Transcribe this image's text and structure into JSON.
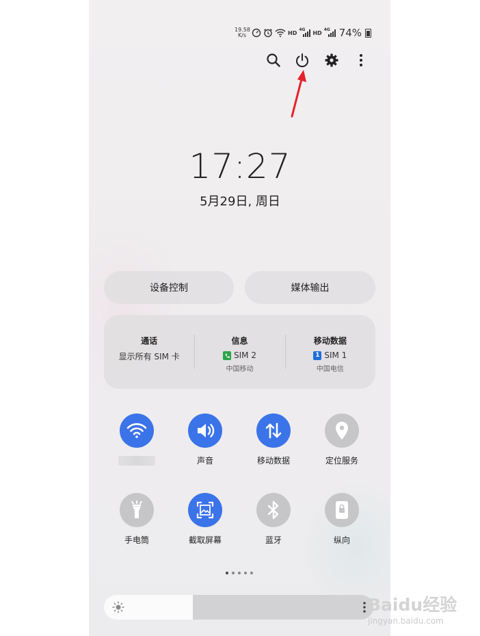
{
  "status_bar": {
    "net_speed_value": "19.58",
    "net_speed_unit": "K/s",
    "icons": [
      "speed-meter-icon",
      "alarm-icon",
      "wifi-icon",
      "hd-icon",
      "signal-4g-icon",
      "hd-icon",
      "signal-4g-icon",
      "battery-icon"
    ],
    "hd_label": "HD",
    "net_label": "4G",
    "battery_percent": "74%",
    "battery_level": 0.74
  },
  "top_actions": [
    "search-icon",
    "power-icon",
    "settings-gear-icon",
    "more-vertical-icon"
  ],
  "annotation": {
    "arrow_color": "#e5202a"
  },
  "clock": {
    "time": "17:27",
    "date": "5月29日, 周日"
  },
  "buttons": {
    "device_control": "设备控制",
    "media_output": "媒体输出"
  },
  "sim_panel": {
    "call": {
      "title": "通话",
      "value": "显示所有 SIM 卡"
    },
    "messages": {
      "title": "信息",
      "sim": "SIM 2",
      "carrier": "中国移动",
      "badge_color": "#2ca54a"
    },
    "mobile_data": {
      "title": "移动数据",
      "sim_num": "1",
      "sim": "SIM 1",
      "carrier": "中国电信",
      "badge_color": "#1e6fd9"
    }
  },
  "tiles": [
    {
      "name": "wifi",
      "label": "",
      "active": true,
      "icon": "wifi-icon"
    },
    {
      "name": "sound",
      "label": "声音",
      "active": true,
      "icon": "speaker-icon"
    },
    {
      "name": "mobile-data",
      "label": "移动数据",
      "active": true,
      "icon": "data-arrows-icon"
    },
    {
      "name": "location",
      "label": "定位服务",
      "active": false,
      "icon": "location-pin-icon"
    },
    {
      "name": "flashlight",
      "label": "手电筒",
      "active": false,
      "icon": "flashlight-icon"
    },
    {
      "name": "screenshot",
      "label": "截取屏幕",
      "active": true,
      "icon": "screenshot-icon"
    },
    {
      "name": "bluetooth",
      "label": "蓝牙",
      "active": false,
      "icon": "bluetooth-icon"
    },
    {
      "name": "portrait",
      "label": "纵向",
      "active": false,
      "icon": "rotation-lock-icon"
    }
  ],
  "colors": {
    "active_tile": "#3b73e9",
    "inactive_tile": "#c6c5c7"
  },
  "pager": {
    "pages": 5,
    "current": 1
  },
  "brightness": {
    "level": 0.33
  },
  "watermark": {
    "brand": "Baidu经验",
    "url": "jingyan.baidu.com"
  }
}
